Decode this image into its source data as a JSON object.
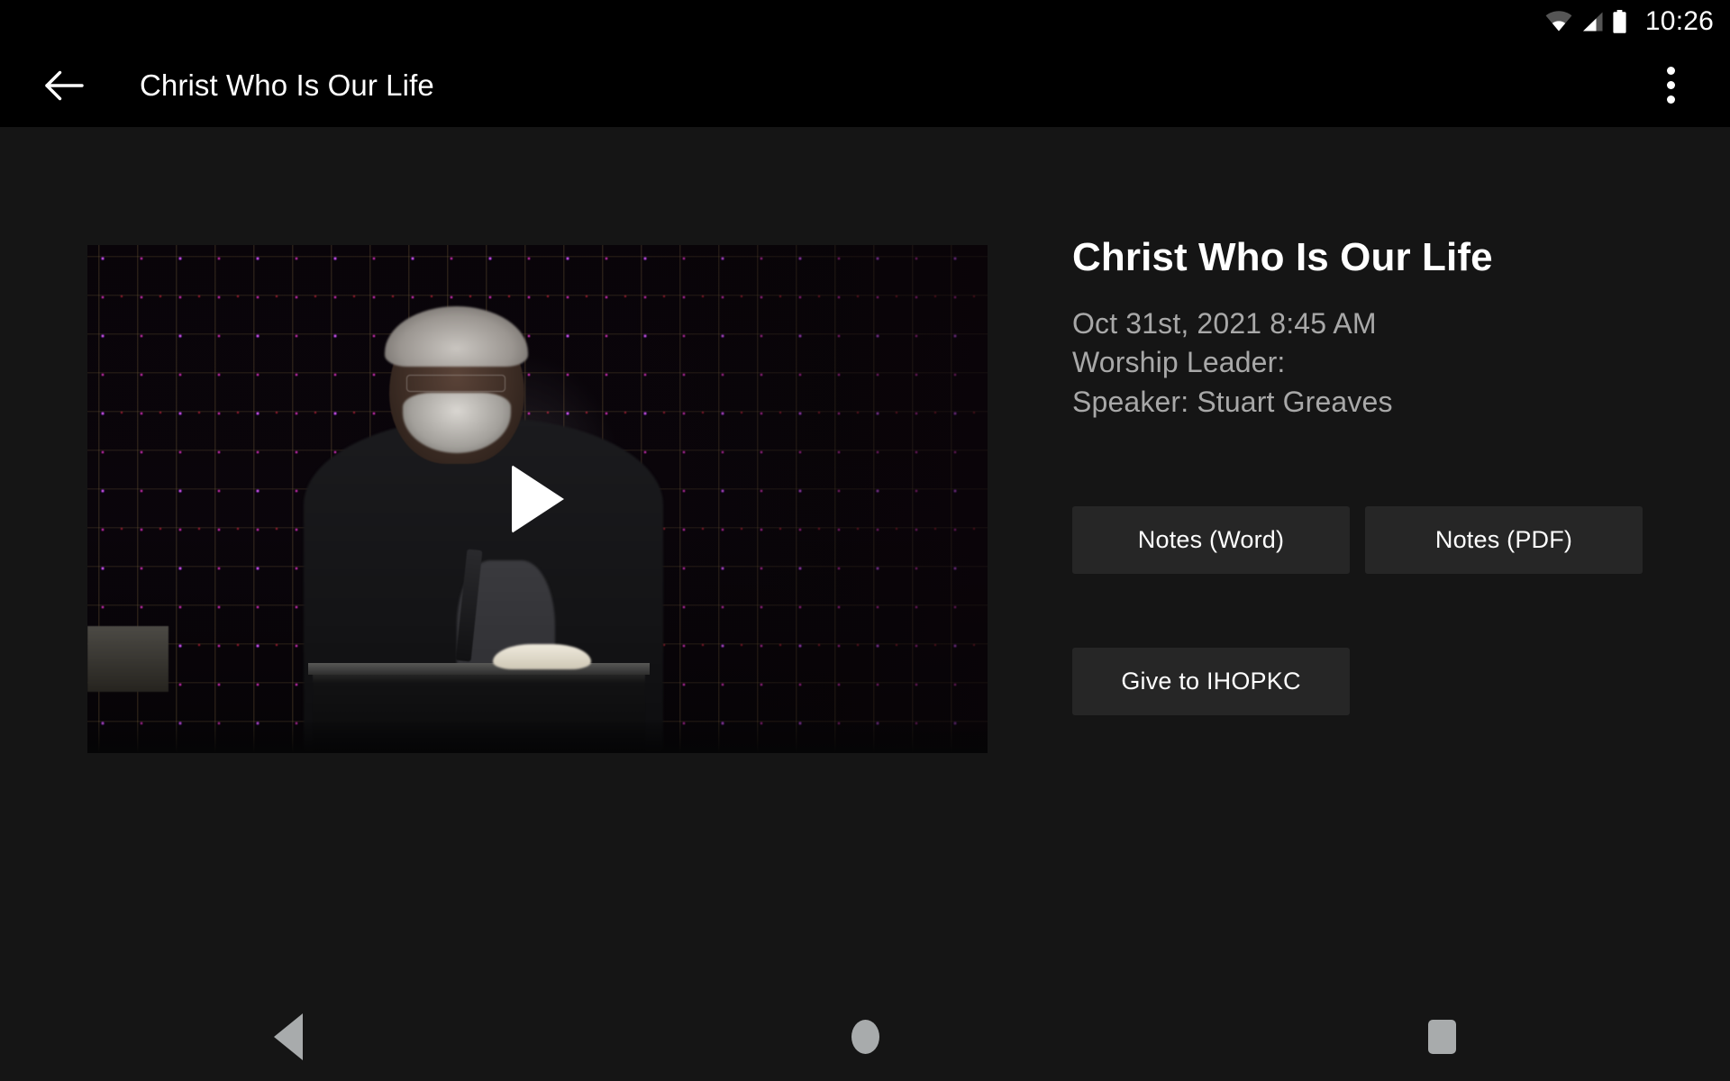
{
  "status_bar": {
    "clock": "10:26",
    "icons": [
      "wifi-icon",
      "cell-signal-icon",
      "battery-icon"
    ]
  },
  "app_bar": {
    "back_icon": "arrow-left-icon",
    "title": "Christ Who Is Our Life",
    "overflow_icon": "more-vertical-icon"
  },
  "video": {
    "play_icon": "play-icon",
    "alt": "Speaker at podium with purple LED light grid backdrop"
  },
  "details": {
    "title": "Christ Who Is Our Life",
    "date": "Oct 31st, 2021 8:45 AM",
    "worship_leader": "Worship Leader:",
    "speaker": "Speaker: Stuart Greaves"
  },
  "buttons": {
    "notes_word": "Notes (Word)",
    "notes_pdf": "Notes (PDF)",
    "give": "Give to IHOPKC"
  },
  "nav_bar": {
    "back": "back-icon",
    "home": "home-icon",
    "recents": "recents-icon"
  },
  "colors": {
    "page_background": "#151515",
    "bar_background": "#000000",
    "button_background": "#262626",
    "primary_text": "#ffffff",
    "secondary_text": "#a8a8a8",
    "nav_icon": "#a8abac"
  }
}
